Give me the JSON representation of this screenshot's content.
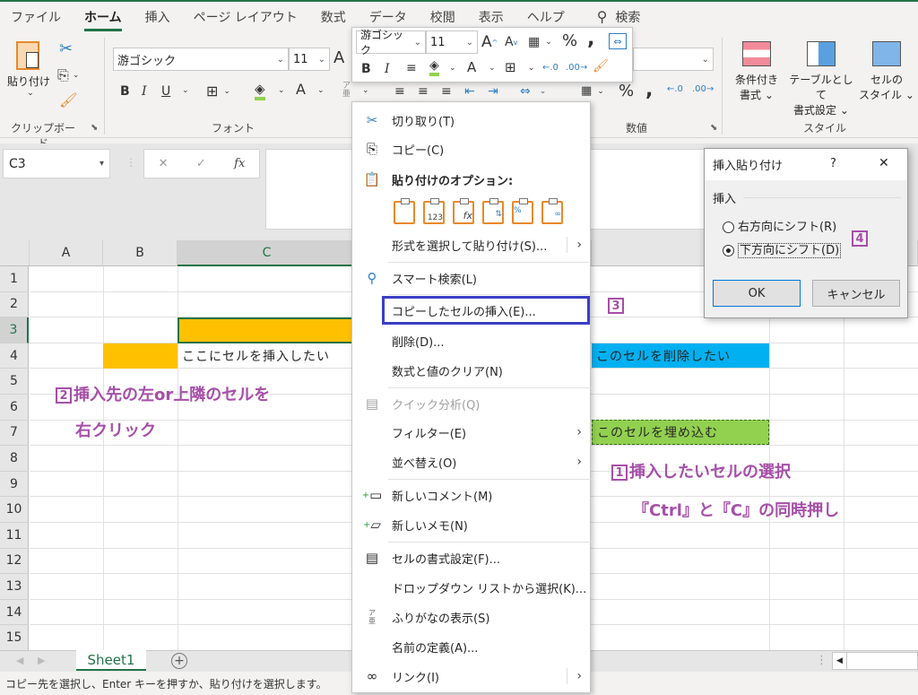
{
  "ribbon": {
    "tabs": [
      "ファイル",
      "ホーム",
      "挿入",
      "ページ レイアウト",
      "数式",
      "データ",
      "校閲",
      "表示",
      "ヘルプ"
    ],
    "active_tab": "ホーム",
    "search_label": "検索",
    "clipboard": {
      "paste_label": "貼り付け",
      "group_label": "クリップボード"
    },
    "font": {
      "name": "游ゴシック",
      "size": "11",
      "group_label": "フォント"
    },
    "number": {
      "group_label": "数値"
    },
    "styles": {
      "conditional_line1": "条件付き",
      "conditional_line2": "書式",
      "table_line1": "テーブルとして",
      "table_line2": "書式設定",
      "cellstyle_line1": "セルの",
      "cellstyle_line2": "スタイル",
      "group_label": "スタイル"
    }
  },
  "mini_toolbar": {
    "font_name": "游ゴシック",
    "font_size": "11"
  },
  "formula_bar": {
    "name_box": "C3",
    "fx_label": "fx",
    "cancel": "✕",
    "enter": "✓",
    "value": ""
  },
  "grid": {
    "columns": [
      "A",
      "B",
      "C"
    ],
    "rows": [
      "1",
      "2",
      "3",
      "4",
      "5",
      "6",
      "7",
      "8",
      "9",
      "10",
      "11",
      "12",
      "13",
      "14",
      "15"
    ],
    "cells": {
      "C4": "ここにセルを挿入したい",
      "E4": "このセルを削除したい",
      "E7": "このセルを埋め込む"
    },
    "colors": {
      "orange": "#ffc000",
      "blue": "#00b0f0",
      "green": "#92d050",
      "annotation": "#a64ea8"
    }
  },
  "annotations": {
    "step1_num": "1",
    "step1_line1": "挿入したいセルの選択",
    "step1_line2": "『Ctrl』と『C』の同時押し",
    "step2_num": "2",
    "step2_line1": "挿入先の左or上隣のセルを",
    "step2_line2": "右クリック",
    "step3_num": "3",
    "step4_num": "4"
  },
  "context_menu": {
    "cut": "切り取り(T)",
    "copy": "コピー(C)",
    "paste_options": "貼り付けのオプション:",
    "paste_special": "形式を選択して貼り付け(S)...",
    "smart_lookup": "スマート検索(L)",
    "insert_copied": "コピーしたセルの挿入(E)...",
    "delete": "削除(D)...",
    "clear": "数式と値のクリア(N)",
    "quick_analysis": "クイック分析(Q)",
    "filter": "フィルター(E)",
    "sort": "並べ替え(O)",
    "new_comment": "新しいコメント(M)",
    "new_note": "新しいメモ(N)",
    "format_cells": "セルの書式設定(F)...",
    "dropdown_pick": "ドロップダウン リストから選択(K)...",
    "phonetic": "ふりがなの表示(S)",
    "define_name": "名前の定義(A)...",
    "link": "リンク(I)",
    "paste_icon_labels": [
      "",
      "123",
      "fx",
      "",
      "%",
      ""
    ]
  },
  "dialog": {
    "title": "挿入貼り付け",
    "help": "?",
    "close": "✕",
    "group": "挿入",
    "option_right": "右方向にシフト(R)",
    "option_down": "下方向にシフト(D)",
    "selected": "down",
    "ok": "OK",
    "cancel": "キャンセル"
  },
  "sheets": {
    "tabs": [
      "Sheet1"
    ],
    "active": "Sheet1",
    "add": "+"
  },
  "status": {
    "message": "コピー先を選択し、Enter キーを押すか、貼り付けを選択します。"
  }
}
